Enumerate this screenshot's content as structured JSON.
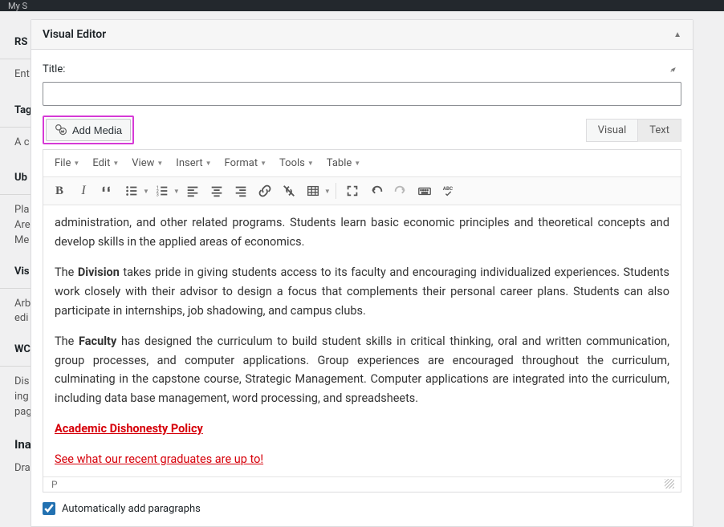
{
  "admin_bar": {
    "site": "My S"
  },
  "sidebar": {
    "items": [
      {
        "label": "RS",
        "sub": "Ent"
      },
      {
        "label": "Tag",
        "sub": "A c"
      },
      {
        "label": "Ub",
        "sub": "Pla\nAre\nMe"
      },
      {
        "label": "Vis",
        "sub": "Arb\nedi"
      },
      {
        "label": "WC",
        "sub": "Dis\ning\npag"
      },
      {
        "label": "Inac",
        "sub": "Drag"
      }
    ]
  },
  "panel": {
    "title": "Visual Editor",
    "title_label": "Title:",
    "title_value": "",
    "add_media": "Add Media",
    "tabs": {
      "visual": "Visual",
      "text": "Text"
    },
    "menus": [
      "File",
      "Edit",
      "View",
      "Insert",
      "Format",
      "Tools",
      "Table"
    ],
    "auto_p_label": "Automatically add paragraphs",
    "auto_p_checked": true,
    "path": "P"
  },
  "content": {
    "p1": "administration, and other related programs. Students learn basic economic principles and theoretical concepts and develop skills in the applied areas of economics.",
    "p2_a": "The ",
    "p2_b": "Division",
    "p2_c": " takes pride in giving students access to its faculty and encouraging individualized experiences. Students work closely with their advisor to design a focus that complements their personal career plans. Students can also participate in internships, job shadowing, and campus clubs.",
    "p3_a": "The ",
    "p3_b": "Faculty",
    "p3_c": " has designed the curriculum to build student skills in critical thinking, oral and written communication, group processes, and computer applications. Group experiences are encouraged throughout the curriculum, culminating in the capstone course, Strategic Management. Computer applications are integrated into the curriculum, including data base management, word processing, and spreadsheets.",
    "link1": "Academic Dishonesty Policy",
    "link2": "See what our recent graduates are up to!"
  }
}
